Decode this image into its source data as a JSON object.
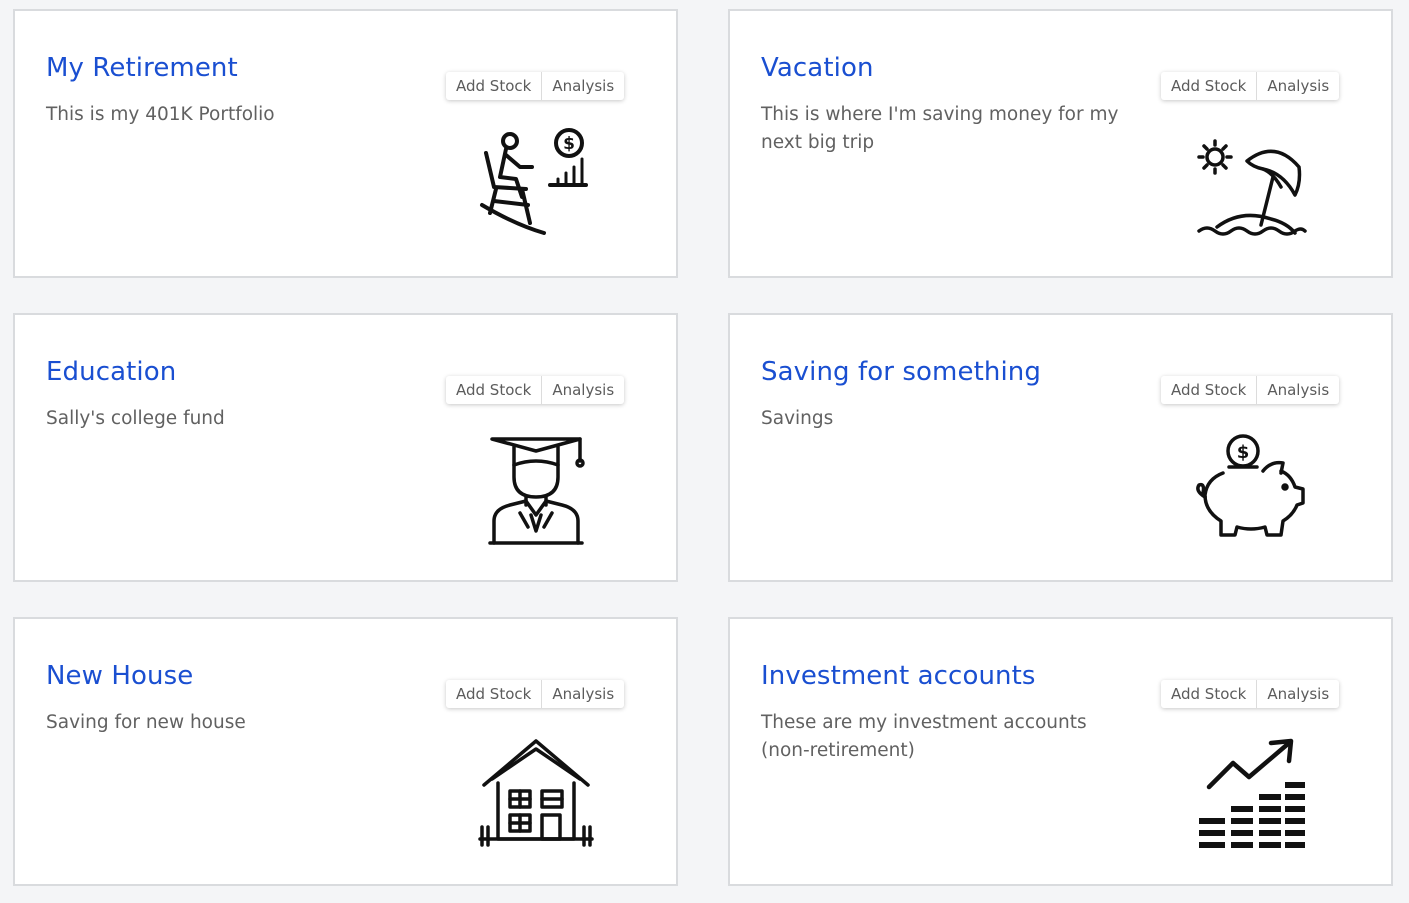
{
  "portfolios": [
    {
      "title": "My Retirement",
      "description": "This is my 401K Portfolio",
      "icon": "retirement-rocking-chair-icon",
      "add_stock_label": "Add Stock",
      "analysis_label": "Analysis"
    },
    {
      "title": "Vacation",
      "description": "This is where I'm saving money for my next big trip",
      "icon": "beach-umbrella-icon",
      "add_stock_label": "Add Stock",
      "analysis_label": "Analysis"
    },
    {
      "title": "Education",
      "description": "Sally's college fund",
      "icon": "graduate-icon",
      "add_stock_label": "Add Stock",
      "analysis_label": "Analysis"
    },
    {
      "title": "Saving for something",
      "description": "Savings",
      "icon": "piggy-bank-icon",
      "add_stock_label": "Add Stock",
      "analysis_label": "Analysis"
    },
    {
      "title": "New House",
      "description": "Saving for new house",
      "icon": "house-icon",
      "add_stock_label": "Add Stock",
      "analysis_label": "Analysis"
    },
    {
      "title": "Investment accounts",
      "description": "These are my investment accounts (non-retirement)",
      "icon": "growth-chart-icon",
      "add_stock_label": "Add Stock",
      "analysis_label": "Analysis"
    }
  ],
  "colors": {
    "title": "#1a4fd1",
    "description": "#616161",
    "background": "#f4f5f7",
    "card": "#ffffff",
    "border": "#d9dbde"
  }
}
